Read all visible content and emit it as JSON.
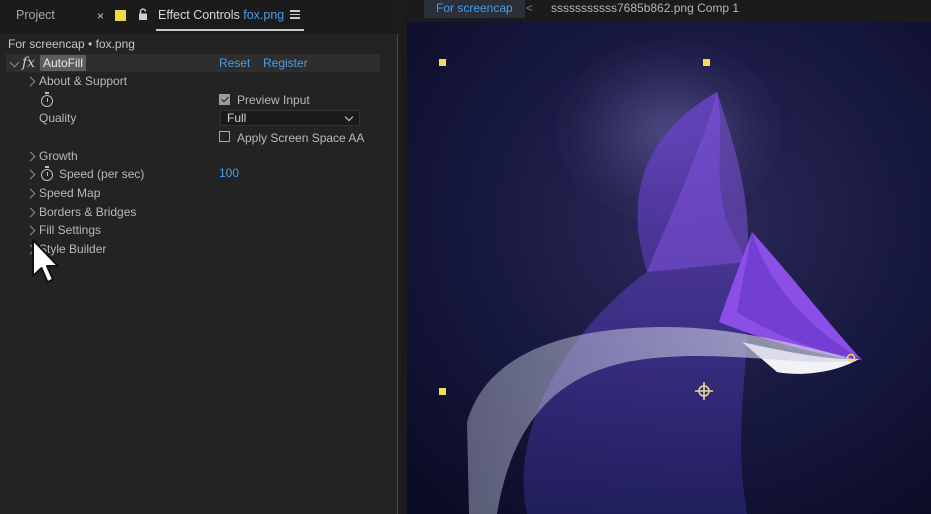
{
  "tabs": {
    "project": "Project",
    "close": "×",
    "effect_controls": "Effect Controls",
    "file": "fox.png"
  },
  "subtitle": "For screencap • fox.png",
  "effect": {
    "fx": "fx",
    "name": "AutoFill",
    "reset": "Reset",
    "register": "Register"
  },
  "rows": {
    "about": "About & Support",
    "preview_input": "Preview Input",
    "quality": "Quality",
    "quality_value": "Full",
    "apply_ssaa": "Apply Screen Space AA",
    "growth": "Growth",
    "speed": "Speed (per sec)",
    "speed_value": "100",
    "speed_map": "Speed Map",
    "borders": "Borders & Bridges",
    "fill_settings": "Fill Settings",
    "style_builder": "Style Builder"
  },
  "states": {
    "preview_input_checked": true,
    "apply_ssaa_checked": false
  },
  "comp": {
    "active_tab": "For screencap",
    "separator": "<",
    "name": "sssssssssss7685b862.png Comp 1"
  },
  "colors": {
    "accent_blue": "#4a9be8",
    "label_swatch": "#f2d94a",
    "handle_yellow": "#f2dc55",
    "fox_purple": "#7b4ad6"
  },
  "icons": {
    "lock": "lock-icon",
    "menu": "hamburger-menu-icon",
    "stopwatch": "stopwatch-icon",
    "cursor": "mouse-pointer-icon",
    "anchor": "anchor-point-icon"
  }
}
